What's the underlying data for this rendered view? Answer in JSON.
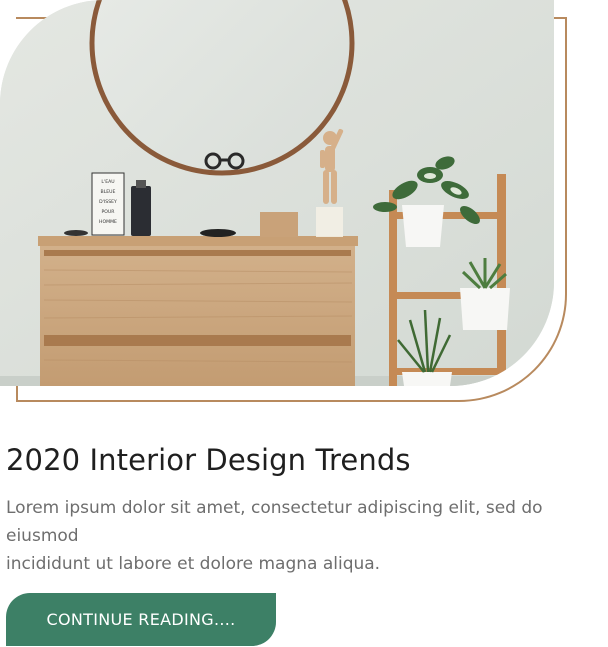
{
  "post": {
    "image_alt": "Room with mirror, wooden dresser and plant ladder",
    "box_lines": [
      "L'EAU",
      "BLEUE",
      "D'ISSEY",
      "POUR",
      "HOMME"
    ],
    "title": "2020 Interior Design Trends",
    "excerpt": "Lorem ipsum dolor sit amet, consectetur adipiscing elit, sed do eiusmod\nincididunt ut labore et dolore magna aliqua.",
    "cta_label": "CONTINUE READING...."
  },
  "colors": {
    "accent_outline": "#b88a5e",
    "button_bg": "#3d8066",
    "title_text": "#1f1f1f",
    "body_text": "#6e6e6e"
  }
}
